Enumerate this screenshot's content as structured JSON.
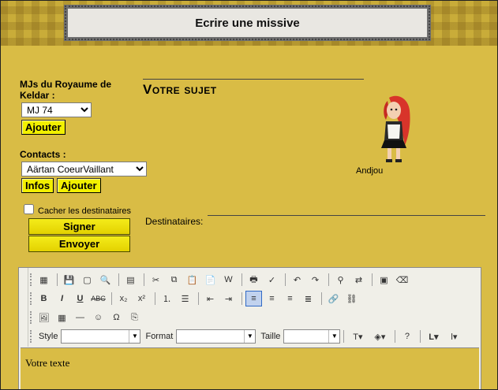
{
  "header": {
    "title": "Ecrire une missive"
  },
  "mj": {
    "label": "MJs du Royaume de Keldar :",
    "selected": "MJ 74",
    "add_label": "Ajouter"
  },
  "contacts": {
    "label": "Contacts :",
    "selected": "Aärtan CoeurVaillant",
    "info_label": "Infos",
    "add_label": "Ajouter"
  },
  "options": {
    "hide_recipients_label": "Cacher les destinataires",
    "hide_recipients_checked": false
  },
  "actions": {
    "sign_label": "Signer",
    "send_label": "Envoyer"
  },
  "subject": {
    "title": "Votre sujet"
  },
  "avatar": {
    "name": "Andjou"
  },
  "recipients": {
    "label": "Destinataires:"
  },
  "editor": {
    "style_label": "Style",
    "format_label": "Format",
    "size_label": "Taille",
    "body_text": "Votre texte",
    "row1_icons": [
      "paste-word-icon",
      "save-icon",
      "new-doc-icon",
      "preview-icon",
      "templates-icon",
      "cut-icon",
      "copy-icon",
      "paste-icon",
      "paste-text-icon",
      "paste-from-word-icon",
      "print-icon",
      "spellcheck-icon",
      "undo-icon",
      "redo-icon",
      "find-icon",
      "replace-icon",
      "select-all-icon",
      "remove-format-icon"
    ],
    "row2_icons": [
      "bold-icon",
      "italic-icon",
      "underline-icon",
      "strikethrough-icon",
      "subscript-icon",
      "superscript-icon",
      "ordered-list-icon",
      "unordered-list-icon",
      "outdent-icon",
      "indent-icon",
      "align-left-icon",
      "align-center-icon",
      "align-right-icon",
      "align-justify-icon",
      "link-icon",
      "unlink-icon"
    ],
    "row3_icons": [
      "image-icon",
      "table-icon",
      "horizontal-rule-icon",
      "smiley-icon",
      "special-char-icon",
      "page-break-icon"
    ]
  }
}
